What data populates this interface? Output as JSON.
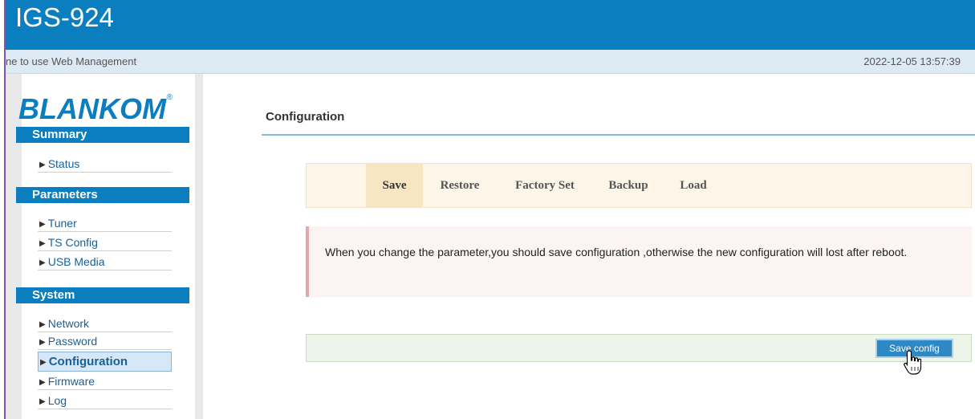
{
  "header": {
    "title": "IGS-924"
  },
  "subbar": {
    "welcome": "ne to use Web Management",
    "datetime": "2022-12-05 13:57:39"
  },
  "logo": {
    "text": "BLANKOM",
    "mark": "®"
  },
  "sidebar": {
    "sections": [
      {
        "title": "Summary",
        "items": [
          {
            "label": "Status"
          }
        ]
      },
      {
        "title": "Parameters",
        "items": [
          {
            "label": "Tuner"
          },
          {
            "label": "TS Config"
          },
          {
            "label": "USB Media"
          }
        ]
      },
      {
        "title": "System",
        "items": [
          {
            "label": "Network"
          },
          {
            "label": "Password"
          },
          {
            "label": "Configuration"
          },
          {
            "label": "Firmware"
          },
          {
            "label": "Log"
          }
        ]
      }
    ],
    "active_item": "Configuration"
  },
  "main": {
    "title": "Configuration",
    "tabs": [
      {
        "label": "Save"
      },
      {
        "label": "Restore"
      },
      {
        "label": "Factory Set"
      },
      {
        "label": "Backup"
      },
      {
        "label": "Load"
      }
    ],
    "active_tab": "Save",
    "alert": "When you change the parameter,you should save configuration ,otherwise the new configuration will lost after reboot.",
    "save_button": "Save config"
  },
  "colors": {
    "header_blue": "#0b7ec0",
    "tab_bg": "#fdf5e7",
    "alert_bg": "#fcf4f3",
    "action_bg": "#edf5ea"
  }
}
